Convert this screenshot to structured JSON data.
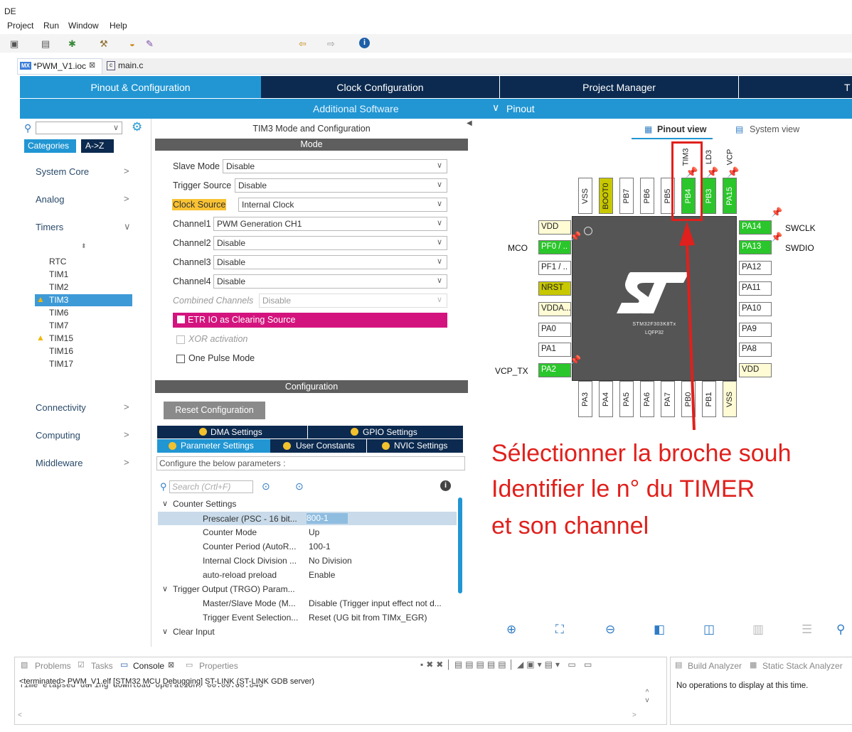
{
  "app": {
    "title_fragment": "DE"
  },
  "menu": [
    "Project",
    "Run",
    "Window",
    "Help"
  ],
  "editor_tabs": [
    {
      "icon": "MX",
      "label": "*PWM_V1.ioc",
      "close": "⊠"
    },
    {
      "label": "main.c"
    }
  ],
  "main_tabs": [
    "Pinout & Configuration",
    "Clock Configuration",
    "Project Manager",
    "T"
  ],
  "sub_bar": {
    "additional_software": "Additional Software",
    "pinout": "Pinout"
  },
  "left_panel": {
    "search_placeholder": "",
    "tab_categories": "Categories",
    "tab_az": "A->Z",
    "categories": [
      {
        "label": "System Core",
        "chev": ">"
      },
      {
        "label": "Analog",
        "chev": ">"
      },
      {
        "label": "Timers",
        "chev": "∨"
      },
      {
        "label": "Connectivity",
        "chev": ">"
      },
      {
        "label": "Computing",
        "chev": ">"
      },
      {
        "label": "Middleware",
        "chev": ">"
      }
    ],
    "timers": [
      "RTC",
      "TIM1",
      "TIM2",
      "TIM3",
      "TIM6",
      "TIM7",
      "TIM15",
      "TIM16",
      "TIM17"
    ],
    "warning_timers": [
      "TIM3",
      "TIM15"
    ],
    "selected_timer": "TIM3"
  },
  "mode_panel": {
    "title": "TIM3 Mode and Configuration",
    "mode_header": "Mode",
    "fields": [
      {
        "label": "Slave Mode",
        "value": "Disable"
      },
      {
        "label": "Trigger Source",
        "value": "Disable"
      },
      {
        "label": "Clock Source",
        "value": "Internal Clock"
      },
      {
        "label": "Channel1",
        "value": "PWM Generation CH1"
      },
      {
        "label": "Channel2",
        "value": "Disable"
      },
      {
        "label": "Channel3",
        "value": "Disable"
      },
      {
        "label": "Channel4",
        "value": "Disable"
      },
      {
        "label": "Combined Channels",
        "value": "Disable"
      }
    ],
    "etr": "ETR IO as Clearing Source",
    "xor": "XOR activation",
    "one_pulse": "One Pulse Mode"
  },
  "config_panel": {
    "header": "Configuration",
    "reset_button": "Reset Configuration",
    "tabs_row1": [
      "DMA Settings",
      "GPIO Settings"
    ],
    "tabs_row2": [
      "Parameter Settings",
      "User Constants",
      "NVIC Settings"
    ],
    "hint": "Configure the below parameters :",
    "search_placeholder": "Search (Crtl+F)",
    "tree": [
      {
        "type": "group",
        "label": "Counter Settings"
      },
      {
        "type": "param",
        "label": "Prescaler (PSC - 16 bit...",
        "value": "800-1",
        "selected": true
      },
      {
        "type": "param",
        "label": "Counter Mode",
        "value": "Up"
      },
      {
        "type": "param",
        "label": "Counter Period (AutoR...",
        "value": "100-1"
      },
      {
        "type": "param",
        "label": "Internal Clock Division ...",
        "value": "No Division"
      },
      {
        "type": "param",
        "label": "auto-reload preload",
        "value": "Enable"
      },
      {
        "type": "group",
        "label": "Trigger Output (TRGO) Param..."
      },
      {
        "type": "param",
        "label": "Master/Slave Mode (M...",
        "value": "Disable (Trigger input effect not d..."
      },
      {
        "type": "param",
        "label": "Trigger Event Selection...",
        "value": "Reset (UG bit from TIMx_EGR)"
      },
      {
        "type": "group",
        "label": "Clear Input"
      }
    ]
  },
  "pinout": {
    "view_tab": "Pinout view",
    "system_tab": "System view",
    "chip_name": "STM32F303K8Tx",
    "chip_package": "LQFP32",
    "top_pins": [
      "VSS",
      "BOOT0",
      "PB7",
      "PB6",
      "PB5",
      "PB4",
      "PB3",
      "PA15"
    ],
    "top_labels": [
      "TIM3",
      "LD3",
      "VCP"
    ],
    "left_pins": [
      "VDD",
      "PF0 / ..",
      "PF1 / ..",
      "NRST",
      "VDDA...",
      "PA0",
      "PA1",
      "PA2"
    ],
    "right_pins": [
      "PA14",
      "PA13",
      "PA12",
      "PA11",
      "PA10",
      "PA9",
      "PA8",
      "VDD"
    ],
    "bottom_pins": [
      "PA3",
      "PA4",
      "PA5",
      "PA6",
      "PA7",
      "PB0",
      "PB1",
      "VSS"
    ],
    "left_labels": {
      "mco": "MCO",
      "vcp_tx": "VCP_TX"
    },
    "right_labels": {
      "swclk": "SWCLK",
      "swdio": "SWDIO"
    }
  },
  "annotation": {
    "lines": [
      "Sélectionner la broche souh",
      "Identifier le n° du TIMER",
      "et son channel"
    ],
    "color": "#e0201c"
  },
  "bottom": {
    "tabs": [
      "Problems",
      "Tasks",
      "Console",
      "Properties"
    ],
    "console_title": "<terminated> PWM_V1.elf [STM32 MCU Debugging] ST-LINK (ST-LINK GDB server)",
    "console_line": "Time elapsed during download operation: 00:00:00.840",
    "right_tabs": [
      "Build Analyzer",
      "Static Stack Analyzer"
    ],
    "right_msg": "No operations to display at this time."
  },
  "colors": {
    "accent_blue": "#2196d3",
    "dark_tab": "#0c2a4f",
    "selected": "#3e9ad6"
  }
}
